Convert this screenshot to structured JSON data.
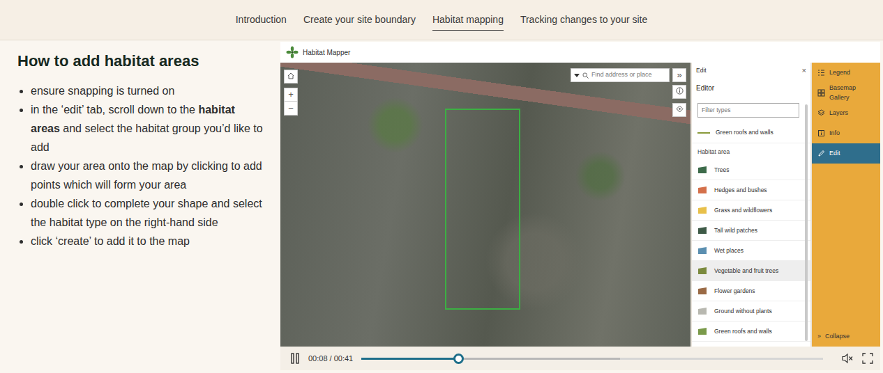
{
  "nav": {
    "tabs": [
      {
        "label": "Introduction",
        "selected": false
      },
      {
        "label": "Create your site boundary",
        "selected": false
      },
      {
        "label": "Habitat mapping",
        "selected": true
      },
      {
        "label": "Tracking changes to your site",
        "selected": false
      }
    ]
  },
  "lesson": {
    "heading": "How to add habitat areas",
    "steps": [
      [
        {
          "text": "ensure snapping is turned on",
          "bold": false
        }
      ],
      [
        {
          "text": "in the ‘edit’ tab, scroll down to the ",
          "bold": false
        },
        {
          "text": "habitat areas",
          "bold": true
        },
        {
          "text": " and select the habitat group you’d like to add",
          "bold": false
        }
      ],
      [
        {
          "text": "draw your area onto the map by clicking to add points which will form your area",
          "bold": false
        }
      ],
      [
        {
          "text": "double click to complete your shape and select the habitat type on the right-hand side",
          "bold": false
        }
      ],
      [
        {
          "text": "click ‘create’ to add it to the map",
          "bold": false
        }
      ]
    ]
  },
  "app": {
    "title": "Habitat Mapper",
    "map": {
      "zoom_in": "+",
      "zoom_out": "−",
      "search": {
        "placeholder": "Find address or place"
      },
      "expand": "»"
    },
    "edit_panel": {
      "title": "Edit",
      "close": "×",
      "heading": "Editor",
      "filter": {
        "placeholder": "Filter types"
      },
      "line_items": [
        {
          "label": "Green roofs and walls",
          "color": "#8a9a3a"
        }
      ],
      "group_label": "Habitat area",
      "items": [
        {
          "label": "Trees",
          "color": "#3d6b4a",
          "hovered": false
        },
        {
          "label": "Hedges and bushes",
          "color": "#d4704a",
          "hovered": false
        },
        {
          "label": "Grass and wildflowers",
          "color": "#e8c04a",
          "hovered": false
        },
        {
          "label": "Tall wild patches",
          "color": "#3e5a47",
          "hovered": false
        },
        {
          "label": "Wet places",
          "color": "#5b8fb0",
          "hovered": false
        },
        {
          "label": "Vegetable and fruit trees",
          "color": "#7b8a3e",
          "hovered": true
        },
        {
          "label": "Flower gardens",
          "color": "#9a6a45",
          "hovered": false
        },
        {
          "label": "Ground without plants",
          "color": "#b8b8b0",
          "hovered": false
        },
        {
          "label": "Green roofs and walls",
          "color": "#7a9a4a",
          "hovered": false
        }
      ]
    },
    "sidebar": {
      "items": [
        {
          "label": "Legend",
          "kind": "legend",
          "selected": false
        },
        {
          "label": "Basemap Gallery",
          "kind": "basemap",
          "selected": false
        },
        {
          "label": "Layers",
          "kind": "layers",
          "selected": false
        },
        {
          "label": "Info",
          "kind": "info",
          "selected": false
        },
        {
          "label": "Edit",
          "kind": "edit",
          "selected": true
        }
      ],
      "collapse": {
        "icon": "»",
        "label": "Collapse"
      }
    }
  },
  "player": {
    "playing": true,
    "time": "00:08 / 00:41",
    "level": 0.21,
    "buffered": 0.56,
    "muted": true
  }
}
